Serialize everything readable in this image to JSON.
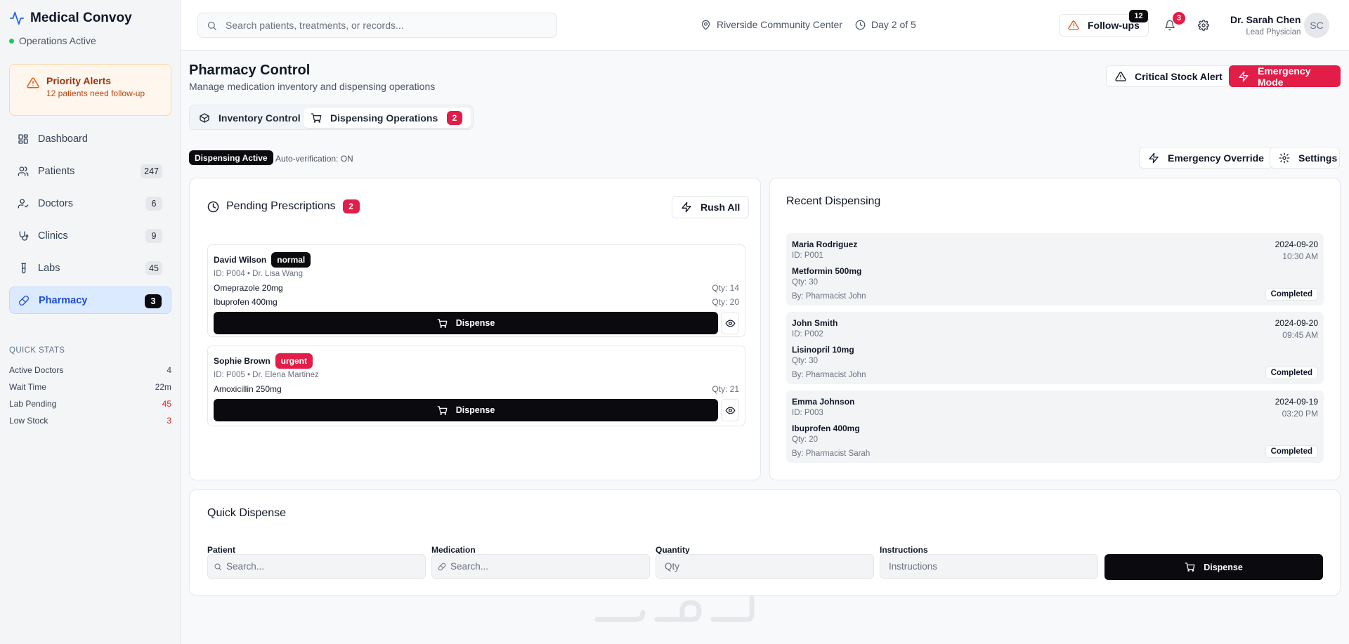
{
  "brand": {
    "title": "Medical Convoy",
    "status": "Operations Active"
  },
  "priority_alert": {
    "title": "Priority Alerts",
    "subtitle": "12 patients need follow-up"
  },
  "nav": [
    {
      "label": "Dashboard",
      "count": "",
      "icon": "dashboard-icon"
    },
    {
      "label": "Patients",
      "count": "247",
      "icon": "users-icon"
    },
    {
      "label": "Doctors",
      "count": "6",
      "icon": "doctor-icon"
    },
    {
      "label": "Clinics",
      "count": "9",
      "icon": "stethoscope-icon"
    },
    {
      "label": "Labs",
      "count": "45",
      "icon": "test-tube-icon"
    },
    {
      "label": "Pharmacy",
      "count": "3",
      "icon": "pill-icon"
    }
  ],
  "quick_stats": {
    "title": "QUICK STATS",
    "rows": [
      {
        "label": "Active Doctors",
        "value": "4",
        "color": "#111827"
      },
      {
        "label": "Wait Time",
        "value": "22m",
        "color": "#111827"
      },
      {
        "label": "Lab Pending",
        "value": "45",
        "color": "#dc2626"
      },
      {
        "label": "Low Stock",
        "value": "3",
        "color": "#dc2626"
      }
    ]
  },
  "header": {
    "search_placeholder": "Search patients, treatments, or records...",
    "location": "Riverside Community Center",
    "day": "Day 2 of 5",
    "followups_label": "Follow-ups",
    "followups_count": "12",
    "notifications_count": "3",
    "user_name": "Dr. Sarah Chen",
    "user_role": "Lead Physician",
    "user_initials": "SC"
  },
  "page": {
    "title": "Pharmacy Control",
    "subtitle": "Manage medication inventory and dispensing operations",
    "critical_btn": "Critical Stock Alert",
    "emergency_btn": "Emergency Mode",
    "tabs": [
      {
        "label": "Inventory Control",
        "badge": ""
      },
      {
        "label": "Dispensing Operations",
        "badge": "2"
      }
    ],
    "dispensing_status": "Dispensing Active",
    "auto_verification": "Auto-verification: ON",
    "override_btn": "Emergency Override",
    "settings_btn": "Settings"
  },
  "pending": {
    "title": "Pending Prescriptions",
    "count": "2",
    "rush_btn": "Rush All",
    "dispense_label": "Dispense",
    "items": [
      {
        "name": "David Wilson",
        "priority": "normal",
        "meta": "ID: P004 • Dr. Lisa Wang",
        "meds": [
          {
            "name": "Omeprazole 20mg",
            "qty": "Qty: 14"
          },
          {
            "name": "Ibuprofen 400mg",
            "qty": "Qty: 20"
          }
        ]
      },
      {
        "name": "Sophie Brown",
        "priority": "urgent",
        "meta": "ID: P005 • Dr. Elena Martinez",
        "meds": [
          {
            "name": "Amoxicillin 250mg",
            "qty": "Qty: 21"
          }
        ]
      }
    ]
  },
  "recent": {
    "title": "Recent Dispensing",
    "items": [
      {
        "name": "Maria Rodriguez",
        "date": "2024-09-20",
        "time": "10:30 AM",
        "id": "ID: P001",
        "med": "Metformin 500mg",
        "qty": "Qty: 30",
        "by": "By: Pharmacist John",
        "status": "Completed"
      },
      {
        "name": "John Smith",
        "date": "2024-09-20",
        "time": "09:45 AM",
        "id": "ID: P002",
        "med": "Lisinopril 10mg",
        "qty": "Qty: 30",
        "by": "By: Pharmacist John",
        "status": "Completed"
      },
      {
        "name": "Emma Johnson",
        "date": "2024-09-19",
        "time": "03:20 PM",
        "id": "ID: P003",
        "med": "Ibuprofen 400mg",
        "qty": "Qty: 20",
        "by": "By: Pharmacist Sarah",
        "status": "Completed"
      }
    ]
  },
  "quick_dispense": {
    "title": "Quick Dispense",
    "patient_label": "Patient",
    "patient_placeholder": "Search...",
    "medication_label": "Medication",
    "medication_placeholder": "Search...",
    "quantity_label": "Quantity",
    "quantity_placeholder": "Qty",
    "instructions_label": "Instructions",
    "instructions_placeholder": "Instructions",
    "dispense_btn": "Dispense"
  },
  "colors": {
    "accent": "#e11d48",
    "primary": "#0b0b0f",
    "active_nav": "#1d4ed8",
    "warning": "#ea580c"
  }
}
